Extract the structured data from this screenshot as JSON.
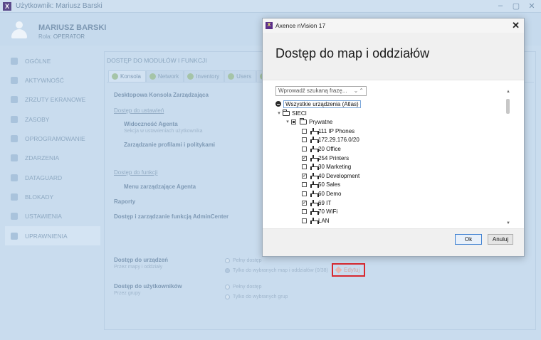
{
  "app": {
    "title": "Użytkownik: Mariusz Barski",
    "logo": "X",
    "user_name": "MARIUSZ BARSKI",
    "role_label": "Rola:",
    "role_value": "OPERATOR"
  },
  "sidebar": {
    "items": [
      {
        "label": "OGÓLNE",
        "icon": "general-icon"
      },
      {
        "label": "AKTYWNOŚĆ",
        "icon": "activity-icon"
      },
      {
        "label": "ZRZUTY EKRANOWE",
        "icon": "screenshot-icon"
      },
      {
        "label": "ZASOBY",
        "icon": "resources-icon"
      },
      {
        "label": "OPROGRAMOWANIE",
        "icon": "software-icon"
      },
      {
        "label": "ZDARZENIA",
        "icon": "events-icon"
      },
      {
        "label": "DATAGUARD",
        "icon": "dataguard-icon"
      },
      {
        "label": "BLOKADY",
        "icon": "warning-icon"
      },
      {
        "label": "USTAWIENIA",
        "icon": "settings-icon"
      },
      {
        "label": "UPRAWNIENIA",
        "icon": "permissions-icon"
      }
    ],
    "active": "UPRAWNIENIA"
  },
  "main": {
    "heading": "DOSTĘP DO MODUŁÓW I FUNKCJI",
    "tabs": [
      "Konsola",
      "Network",
      "Inventory",
      "Users",
      "",
      ""
    ],
    "console_title": "Desktopowa Konsola Zarządzająca",
    "settings_link": "Dostęp do ustawień",
    "agent_visibility": "Widoczność Agenta",
    "agent_visibility_sub": "Sekcja w ustawieniach użytkownika",
    "profiles": "Zarządzanie profilami i politykami",
    "functions_link": "Dostęp do funkcji",
    "agent_menu": "Menu zarządzające Agenta",
    "reports": "Raporty",
    "admincenter": "Dostęp i zarządzanie funkcją AdminCenter",
    "devices_title": "Dostęp do urządzeń",
    "devices_sub": "Przez mapy i oddziały",
    "devices_full": "Pełny dostęp",
    "devices_selected": "Tylko do wybranych map i oddziałów (0/38)",
    "edit_label": "Edytuj",
    "users_title": "Dostęp do użytkowników",
    "users_sub": "Przez grupy",
    "users_full": "Pełny dostęp",
    "users_selected": "Tylko do wybranych grup"
  },
  "dialog": {
    "window_title": "Axence nVision 17",
    "logo": "X",
    "heading": "Dostęp do map i oddziałów",
    "search_placeholder": "Wprowadź szukaną frazę...",
    "tree": [
      {
        "label": "Wszystkie urządzenia (Atlas)",
        "level": 0,
        "type": "globe",
        "checked": null
      },
      {
        "label": "SIECI",
        "level": 0,
        "type": "folder",
        "checked": null
      },
      {
        "label": "Prywatne",
        "level": 1,
        "type": "folder",
        "checked": "partial"
      },
      {
        "label": "111 IP Phones",
        "level": 2,
        "type": "net",
        "checked": false
      },
      {
        "label": "172.29.176.0/20",
        "level": 2,
        "type": "net",
        "checked": false
      },
      {
        "label": "20 Office",
        "level": 2,
        "type": "net",
        "checked": false
      },
      {
        "label": "254 Printers",
        "level": 2,
        "type": "net",
        "checked": true
      },
      {
        "label": "30 Marketing",
        "level": 2,
        "type": "net",
        "checked": false
      },
      {
        "label": "40 Development",
        "level": 2,
        "type": "net",
        "checked": true
      },
      {
        "label": "50 Sales",
        "level": 2,
        "type": "net",
        "checked": false
      },
      {
        "label": "60 Demo",
        "level": 2,
        "type": "net",
        "checked": false
      },
      {
        "label": "69 IT",
        "level": 2,
        "type": "net",
        "checked": true
      },
      {
        "label": "70 WiFi",
        "level": 2,
        "type": "net",
        "checked": false
      },
      {
        "label": "LAN",
        "level": 2,
        "type": "net",
        "checked": false
      }
    ],
    "ok_label": "Ok",
    "cancel_label": "Anuluj"
  }
}
